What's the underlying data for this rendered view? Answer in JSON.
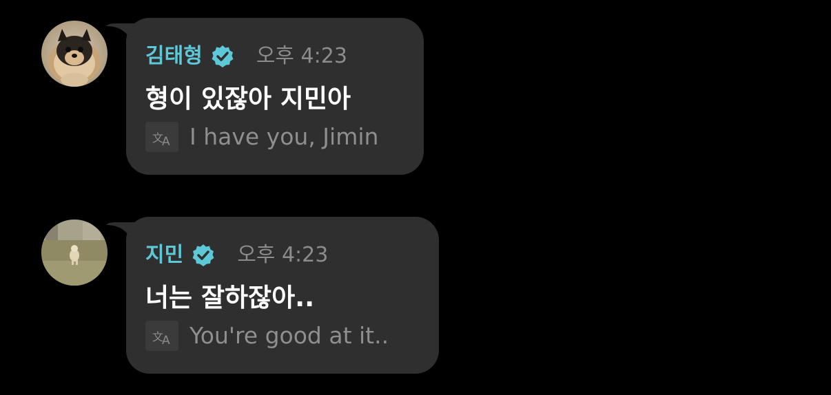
{
  "messages": [
    {
      "sender": "김태형",
      "verified_icon": "verified-badge-icon",
      "time": "오후 4:23",
      "text": "형이 있잖아 지민아",
      "translate_icon": "translate-icon",
      "translation": "I have you, Jimin"
    },
    {
      "sender": "지민",
      "verified_icon": "verified-badge-icon",
      "time": "오후 4:23",
      "text": "너는 잘하잖아..",
      "translate_icon": "translate-icon",
      "translation": "You're good at it.."
    }
  ],
  "colors": {
    "background": "#000000",
    "bubble": "#2f2f2f",
    "sender_name": "#5cc8d8",
    "verified_badge": "#5cc8d8",
    "time": "#8c8c8c",
    "message_text": "#ffffff",
    "translation_text": "#8f8f8f"
  }
}
